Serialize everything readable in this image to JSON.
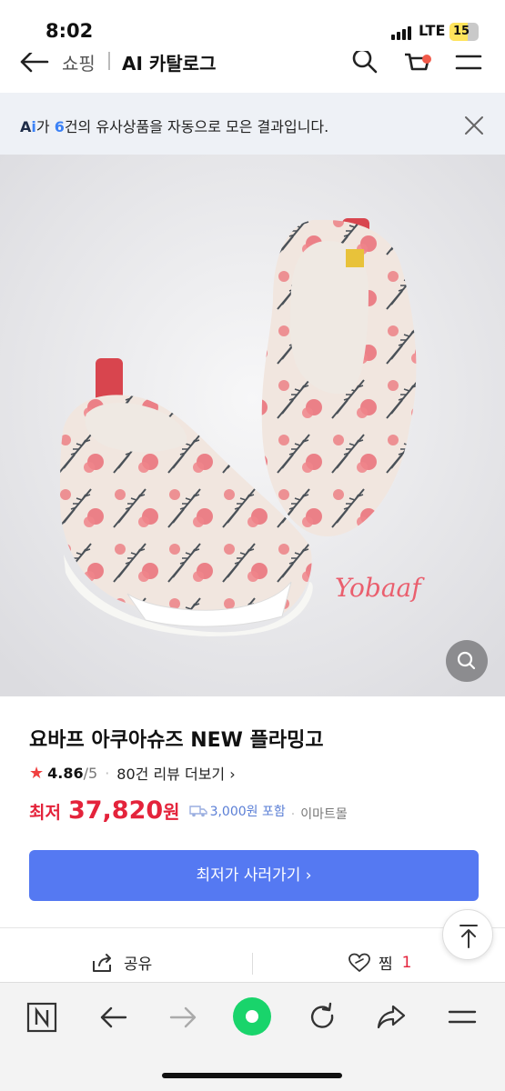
{
  "status_bar": {
    "time": "8:02",
    "network": "LTE",
    "battery": "15"
  },
  "header": {
    "crumb_1": "쇼핑",
    "crumb_2": "AI 카탈로그"
  },
  "ai_banner": {
    "logo_a": "A",
    "logo_i": "i",
    "text_prefix": "가 ",
    "count": "6",
    "text_suffix": "건의 유사상품을 자동으로 모은 결과입니다."
  },
  "product": {
    "image_brand": "Yobaaf",
    "title": "요바프 아쿠아슈즈 NEW 플라밍고",
    "rating": {
      "score": "4.86",
      "out_of": "/5",
      "reviews": "80건 리뷰 더보기"
    },
    "price": {
      "label": "최저",
      "value": "37,820",
      "unit": "원",
      "shipping": "3,000원 포함",
      "shop": "이마트몰"
    },
    "buy_label": "최저가 사러가기"
  },
  "actions": {
    "share_label": "공유",
    "like_label": "찜",
    "like_count": "1"
  },
  "colors": {
    "accent_blue": "#5579f2",
    "price_red": "#e4233b",
    "ai_blue": "#3c82f6"
  }
}
